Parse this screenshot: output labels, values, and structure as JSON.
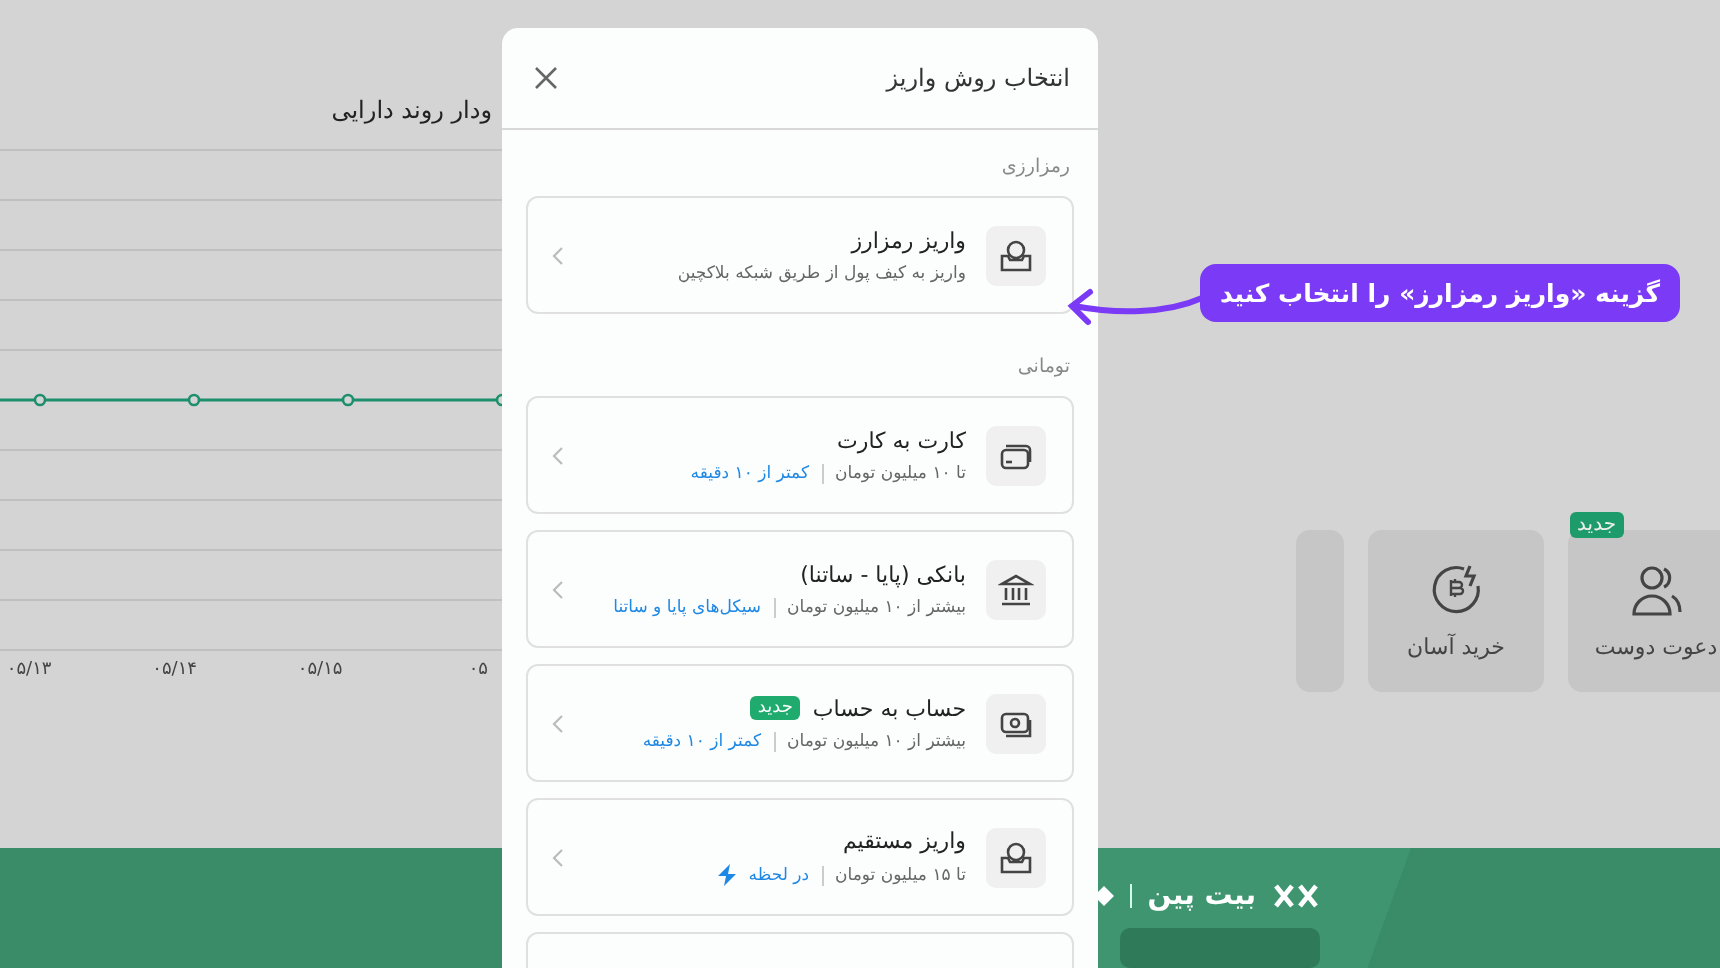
{
  "chart": {
    "title": "ودار روند دارایی",
    "x_labels": [
      "۰۵",
      "۰۵/۱۵",
      "۰۵/۱۴",
      "۰۵/۱۳"
    ]
  },
  "quick_actions": [
    {
      "kind": "friends",
      "label": "دعوت دوست",
      "badge": "جدید"
    },
    {
      "kind": "easy-buy",
      "label": "خرید آسان"
    },
    {
      "kind": "cut"
    }
  ],
  "banner": {
    "brand": "بیت پین"
  },
  "modal": {
    "title": "انتخاب روش واریز",
    "sections": [
      {
        "heading": "رمزارزی",
        "methods": [
          {
            "kind": "crypto",
            "title": "واریز رمزارز",
            "subtitle": "واریز به کیف پول از طریق شبکه بلاکچین"
          }
        ]
      },
      {
        "heading": "تومانی",
        "methods": [
          {
            "kind": "card",
            "title": "کارت به کارت",
            "limit": "تا ۱۰ میلیون تومان",
            "speed": "کمتر از ۱۰ دقیقه"
          },
          {
            "kind": "bank",
            "title": "بانکی (پایا - ساتنا)",
            "limit": "بیشتر از ۱۰ میلیون تومان",
            "speed": "سیکل‌های پایا و ساتنا"
          },
          {
            "kind": "account",
            "title": "حساب به حساب",
            "badge": "جدید",
            "limit": "بیشتر از ۱۰ میلیون تومان",
            "speed": "کمتر از ۱۰ دقیقه"
          },
          {
            "kind": "direct",
            "title": "واریز مستقیم",
            "limit": "تا ۱۵ میلیون تومان",
            "speed": "در لحظه"
          },
          {
            "kind": "cut"
          }
        ]
      }
    ]
  },
  "callout": "گزینه «واریز رمزارز» را انتخاب کنید"
}
